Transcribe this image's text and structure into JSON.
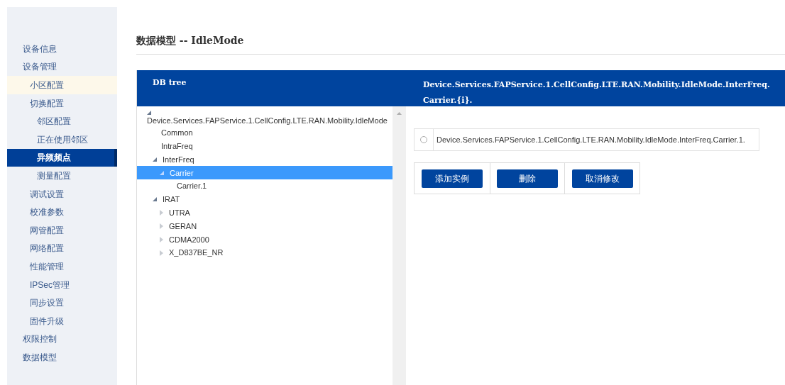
{
  "sidebar": {
    "items": [
      {
        "label": "设备信息",
        "selected": false,
        "highlighted": false
      },
      {
        "label": "设备管理",
        "selected": false,
        "highlighted": false,
        "children": [
          {
            "label": "小区配置",
            "selected": false,
            "highlighted": true
          },
          {
            "label": "切换配置",
            "selected": false,
            "highlighted": false,
            "children": [
              {
                "label": "邻区配置",
                "selected": false,
                "highlighted": false
              },
              {
                "label": "正在使用邻区",
                "selected": false,
                "highlighted": false
              },
              {
                "label": "异频频点",
                "selected": true,
                "highlighted": false
              },
              {
                "label": "测量配置",
                "selected": false,
                "highlighted": false
              }
            ]
          },
          {
            "label": "调试设置",
            "selected": false,
            "highlighted": false
          },
          {
            "label": "校准参数",
            "selected": false,
            "highlighted": false
          },
          {
            "label": "网管配置",
            "selected": false,
            "highlighted": false
          },
          {
            "label": "网络配置",
            "selected": false,
            "highlighted": false
          },
          {
            "label": "性能管理",
            "selected": false,
            "highlighted": false
          },
          {
            "label": "IPSec管理",
            "selected": false,
            "highlighted": false
          },
          {
            "label": "同步设置",
            "selected": false,
            "highlighted": false
          },
          {
            "label": "固件升级",
            "selected": false,
            "highlighted": false
          }
        ]
      },
      {
        "label": "权限控制",
        "selected": false,
        "highlighted": false
      },
      {
        "label": "数据模型",
        "selected": false,
        "highlighted": false
      }
    ]
  },
  "page_title": "数据模型 -- IdleMode",
  "db_tree": {
    "header": "DB tree",
    "nodes": [
      {
        "label": "Device.Services.FAPService.1.CellConfig.LTE.RAN.Mobility.IdleMode",
        "kind": "branch",
        "expanded": true,
        "selected": false,
        "children": [
          {
            "label": "Common",
            "kind": "leaf",
            "selected": false
          },
          {
            "label": "IntraFreq",
            "kind": "leaf",
            "selected": false
          },
          {
            "label": "InterFreq",
            "kind": "branch",
            "expanded": true,
            "selected": false,
            "children": [
              {
                "label": "Carrier",
                "kind": "branch",
                "expanded": true,
                "selected": true,
                "children": [
                  {
                    "label": "Carrier.1",
                    "kind": "leaf",
                    "selected": false
                  }
                ]
              }
            ]
          },
          {
            "label": "IRAT",
            "kind": "branch",
            "expanded": true,
            "selected": false,
            "children": [
              {
                "label": "UTRA",
                "kind": "branch",
                "expanded": false,
                "selected": false
              },
              {
                "label": "GERAN",
                "kind": "branch",
                "expanded": false,
                "selected": false
              },
              {
                "label": "CDMA2000",
                "kind": "branch",
                "expanded": false,
                "selected": false
              },
              {
                "label": "X_D837BE_NR",
                "kind": "branch",
                "expanded": false,
                "selected": false
              }
            ]
          }
        ]
      }
    ]
  },
  "detail": {
    "header": "Device.Services.FAPService.1.CellConfig.LTE.RAN.Mobility.IdleMode.InterFreq.Carrier.{i}.",
    "instances": [
      {
        "label": "Device.Services.FAPService.1.CellConfig.LTE.RAN.Mobility.IdleMode.InterFreq.Carrier.1.",
        "selected": false
      }
    ],
    "buttons": [
      "添加实例",
      "删除",
      "取消修改"
    ]
  }
}
